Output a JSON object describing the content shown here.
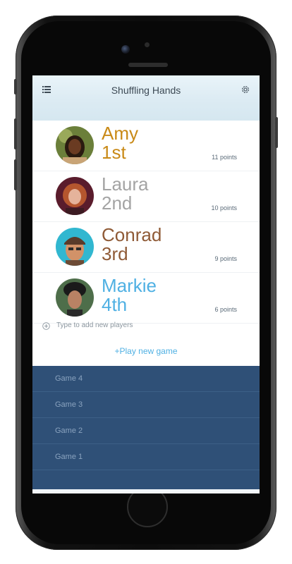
{
  "app": {
    "title": "Shuffling Hands"
  },
  "players": [
    {
      "name": "Amy",
      "rank": "1st",
      "points": "11 points",
      "color": "#c98a17"
    },
    {
      "name": "Laura",
      "rank": "2nd",
      "points": "10 points",
      "color": "#a4a4a4"
    },
    {
      "name": "Conrad",
      "rank": "3rd",
      "points": "9 points",
      "color": "#8f5a36"
    },
    {
      "name": "Markie",
      "rank": "4th",
      "points": "6 points",
      "color": "#4fb0e3"
    }
  ],
  "add_players": {
    "placeholder": "Type to add new players"
  },
  "play_new_game": "+Play new game",
  "games": [
    {
      "label": "Game 4"
    },
    {
      "label": "Game 3"
    },
    {
      "label": "Game 2"
    },
    {
      "label": "Game 1"
    }
  ],
  "icons": {
    "menu": "menu-list-icon",
    "settings": "gear-icon",
    "add": "plus-circle-icon"
  },
  "colors": {
    "accent": "#4fb0e3",
    "games_bg": "#2f5077",
    "header_bg": "#dcebf3"
  }
}
